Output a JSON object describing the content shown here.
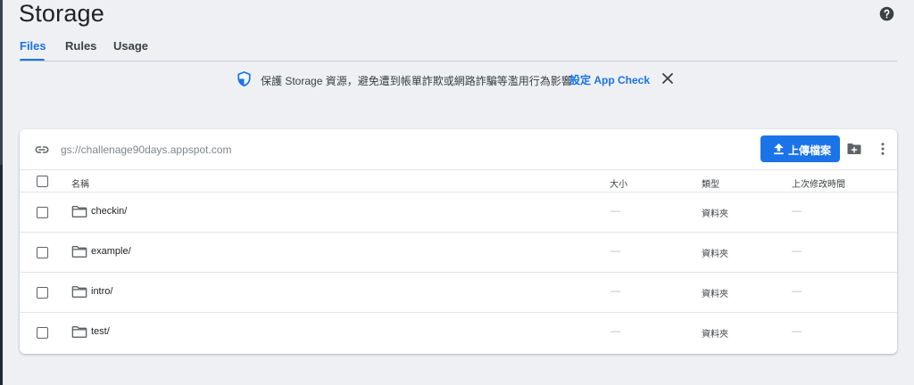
{
  "page": {
    "title": "Storage"
  },
  "tabs": [
    {
      "label": "Files",
      "active": true
    },
    {
      "label": "Rules",
      "active": false
    },
    {
      "label": "Usage",
      "active": false
    }
  ],
  "banner": {
    "text": "保護 Storage 資源，避免遭到帳單詐欺或網路詐騙等濫用行為影響",
    "link_label": "設定 App Check"
  },
  "bucket": {
    "path": "gs://challenage90days.appspot.com",
    "upload_label": "上傳檔案"
  },
  "table": {
    "headers": {
      "name": "名稱",
      "size": "大小",
      "type": "類型",
      "modified": "上次修改時間"
    },
    "rows": [
      {
        "name": "checkin/",
        "size": "—",
        "type": "資料夾",
        "modified": "—"
      },
      {
        "name": "example/",
        "size": "—",
        "type": "資料夾",
        "modified": "—"
      },
      {
        "name": "intro/",
        "size": "—",
        "type": "資料夾",
        "modified": "—"
      },
      {
        "name": "test/",
        "size": "—",
        "type": "資料夾",
        "modified": "—"
      }
    ]
  },
  "icons": [
    "help-icon",
    "shield-icon",
    "close-icon",
    "link-icon",
    "upload-icon",
    "new-folder-icon",
    "more-vert-icon",
    "folder-icon"
  ],
  "colors": {
    "accent": "#1a73e8",
    "background": "#eef0f3",
    "card": "#ffffff"
  }
}
